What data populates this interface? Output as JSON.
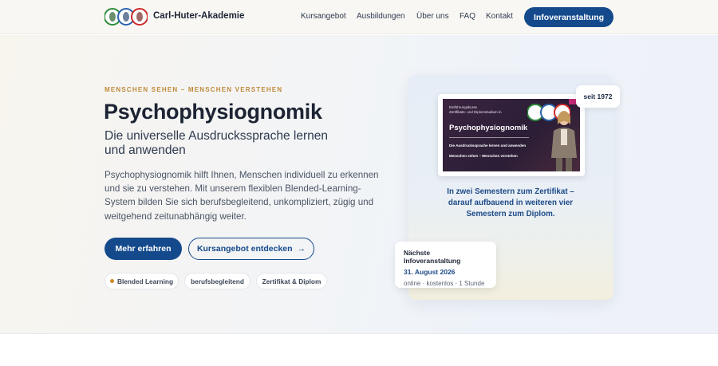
{
  "header": {
    "brand": "Carl-Huter-Akademie",
    "nav": [
      "Kursangebot",
      "Ausbildungen",
      "Über uns",
      "FAQ",
      "Kontakt"
    ],
    "cta": "Infoveranstaltung"
  },
  "hero": {
    "eyebrow": "MENSCHEN SEHEN – MENSCHEN VERSTEHEN",
    "title": "Psychophysiognomik",
    "subtitle": "Die universelle Ausdruckssprache lernen und anwenden",
    "lead": "Psychophysiognomik hilft Ihnen, Menschen individuell zu erkennen und sie zu verstehen. Mit unserem flexiblen Blended-Learning-System bilden Sie sich berufsbegleitend, unkompliziert, zügig und weitgehend zeitunabhängig weiter.",
    "primary_button": "Mehr erfahren",
    "secondary_button": "Kursangebot entdecken",
    "secondary_arrow": "→",
    "chips": [
      "Blended Learning",
      "berufsbegleitend",
      "Zertifikat & Diplom"
    ]
  },
  "visual": {
    "badge": "seit 1972",
    "preview": {
      "line1": "Einführungskurse",
      "line2": "Zertifikats- und Diplomstudium in",
      "title": "Psychophysiognomik",
      "sub1": "Die Ausdruckssprache lernen und anwenden",
      "sub2": "Menschen sehen – Menschen verstehen"
    },
    "text": "In zwei Semestern zum Zertifikat – darauf aufbauend in weiteren vier Semestern zum Diplom.",
    "event": {
      "title": "Nächste Infoveranstaltung",
      "date": "31. August 2026",
      "meta": "online · kostenlos · 1 Stunde"
    }
  },
  "colors": {
    "primary": "#144a8c",
    "accent": "#c0893a",
    "text": "#1c2434"
  },
  "icons": [
    "logo-faces-icon",
    "arrow-right-icon",
    "dot-icon"
  ]
}
